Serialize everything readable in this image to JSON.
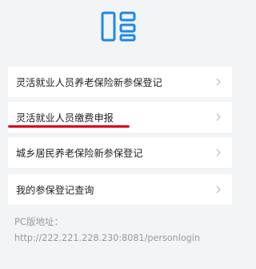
{
  "logo": {
    "icon": "grid-icon",
    "color": "#1e88e5"
  },
  "menu": {
    "items": [
      {
        "label": "灵活就业人员养老保险新参保登记",
        "icon": "chevron-right-icon"
      },
      {
        "label": "灵活就业人员缴费申报",
        "icon": "chevron-right-icon"
      },
      {
        "label": "城乡居民养老保险新参保登记",
        "icon": "chevron-right-icon"
      },
      {
        "label": "我的参保登记查询",
        "icon": "chevron-right-icon"
      }
    ]
  },
  "highlight": {
    "color": "#d9001b"
  },
  "footer": {
    "pc_label": "PC版地址：",
    "pc_url": "http://222.221.228.230:8081/personlogin"
  }
}
